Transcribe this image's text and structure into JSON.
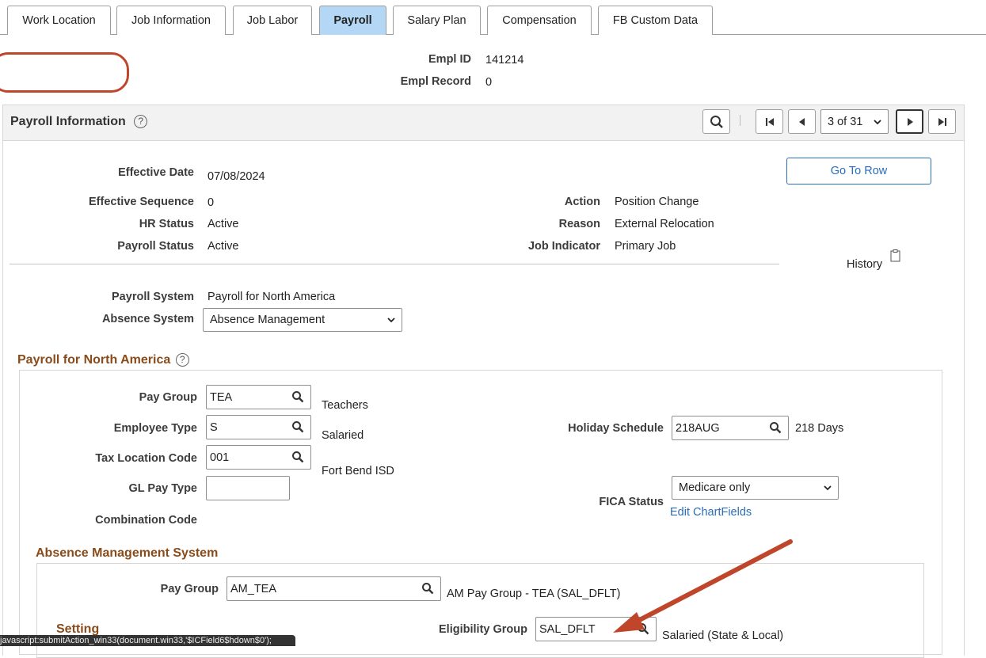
{
  "tabs": [
    {
      "label": "Work Location",
      "active": false
    },
    {
      "label": "Job Information",
      "active": false
    },
    {
      "label": "Job Labor",
      "active": false
    },
    {
      "label": "Payroll",
      "active": true
    },
    {
      "label": "Salary Plan",
      "active": false
    },
    {
      "label": "Compensation",
      "active": false
    },
    {
      "label": "FB Custom Data",
      "active": false
    }
  ],
  "header": {
    "empl_id_label": "Empl ID",
    "empl_id": "141214",
    "empl_record_label": "Empl Record",
    "empl_record": "0"
  },
  "payroll_info": {
    "title": "Payroll Information",
    "row_counter": "3 of 31",
    "go_to_row": "Go To Row",
    "effective_date_label": "Effective Date",
    "effective_date": "07/08/2024",
    "effective_sequence_label": "Effective Sequence",
    "effective_sequence": "0",
    "hr_status_label": "HR Status",
    "hr_status": "Active",
    "payroll_status_label": "Payroll Status",
    "payroll_status": "Active",
    "action_label": "Action",
    "action": "Position Change",
    "reason_label": "Reason",
    "reason": "External Relocation",
    "job_indicator_label": "Job Indicator",
    "job_indicator": "Primary Job",
    "history_label": "History",
    "payroll_system_label": "Payroll System",
    "payroll_system": "Payroll for North America",
    "absence_system_label": "Absence System",
    "absence_system": "Absence Management"
  },
  "pna": {
    "title": "Payroll for North America",
    "pay_group_label": "Pay Group",
    "pay_group": "TEA",
    "pay_group_desc": "Teachers",
    "employee_type_label": "Employee Type",
    "employee_type": "S",
    "employee_type_desc": "Salaried",
    "tax_location_label": "Tax Location Code",
    "tax_location": "001",
    "tax_location_desc": "Fort Bend ISD",
    "gl_pay_type_label": "GL Pay Type",
    "gl_pay_type": "",
    "combination_code_label": "Combination Code",
    "holiday_schedule_label": "Holiday Schedule",
    "holiday_schedule": "218AUG",
    "holiday_schedule_desc": "218 Days",
    "fica_status_label": "FICA Status",
    "fica_status": "Medicare only",
    "edit_chartfields": "Edit ChartFields"
  },
  "ams": {
    "title": "Absence Management System",
    "pay_group_label": "Pay Group",
    "pay_group": "AM_TEA",
    "pay_group_desc": "AM Pay Group - TEA (SAL_DFLT)",
    "setting_label": "Setting",
    "eligibility_group_label": "Eligibility Group",
    "eligibility_group": "SAL_DFLT",
    "eligibility_group_desc": "Salaried (State & Local)"
  },
  "status_bar": "javascript:submitAction_win33(document.win33,'$ICField6$hdown$0');",
  "colors": {
    "annotation": "#c0462b",
    "active_tab": "#b3d7f5",
    "section_title": "#8a4b1a",
    "link": "#2a6ebb"
  }
}
